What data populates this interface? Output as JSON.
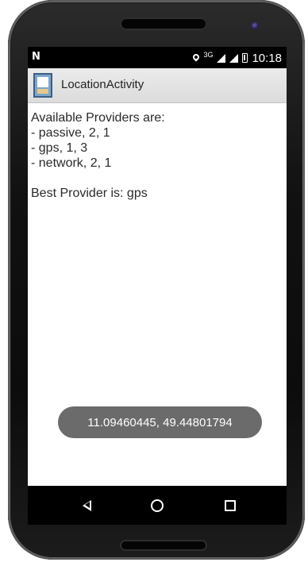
{
  "status_bar": {
    "left_icon": "N",
    "network_type": "3G",
    "time": "10:18",
    "icons": [
      "notification-n-icon",
      "location-pin-icon",
      "signal-3g-icon",
      "signal-icon",
      "battery-icon"
    ]
  },
  "app_bar": {
    "title": "LocationActivity",
    "icon": "app-launcher-icon"
  },
  "content": {
    "heading": "Available Providers are:",
    "providers": [
      "- passive, 2, 1",
      "- gps, 1, 3",
      "- network, 2, 1"
    ],
    "best_provider": "Best Provider is: gps"
  },
  "toast": {
    "text": "11.09460445, 49.44801794"
  },
  "nav_bar": {
    "buttons": [
      "back-icon",
      "home-icon",
      "recents-icon"
    ]
  }
}
